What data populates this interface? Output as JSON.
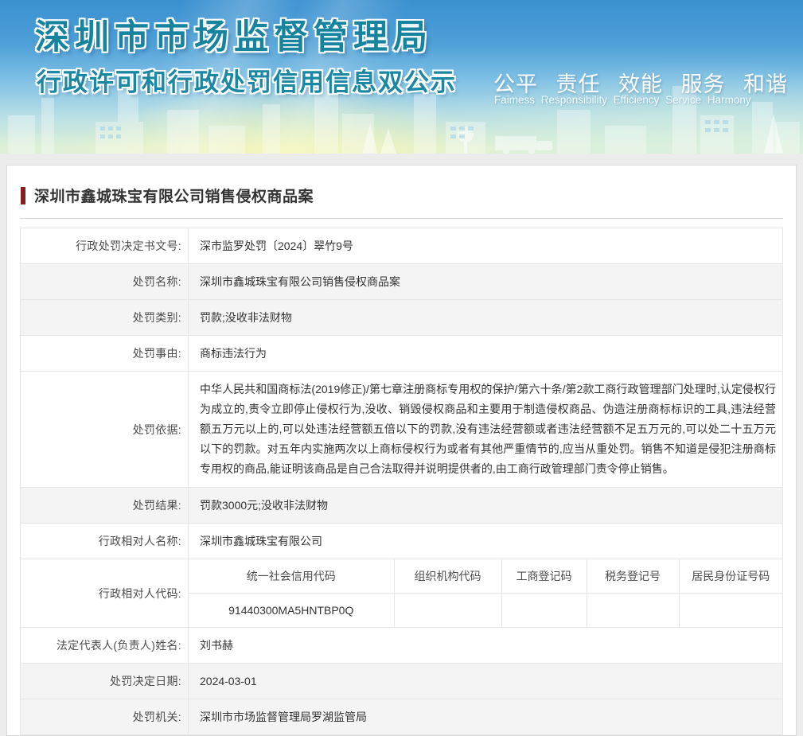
{
  "header": {
    "org_name": "深圳市市场监督管理局",
    "banner_subtitle": "行政许可和行政处罚信用信息双公示",
    "slogan_cn": "公平  责任  效能  服务  和谐",
    "slogan_en": "Faimess  Responsibility  Efficiency  Service  Harmony",
    "colors": {
      "title_teal": "#16839f",
      "top_blue": "#3a90d0",
      "bottom_glow": "#faf6aa"
    }
  },
  "page": {
    "title": "深圳市鑫城珠宝有限公司销售侵权商品案",
    "accent_color": "#8a1d22",
    "shaded_row_color": "#f4f4f4"
  },
  "penalty_table": {
    "rows": [
      {
        "label": "行政处罚决定书文号:",
        "value": "深市监罗处罚〔2024〕翠竹9号"
      },
      {
        "label": "处罚名称:",
        "value": "深圳市鑫城珠宝有限公司销售侵权商品案"
      },
      {
        "label": "处罚类别:",
        "value": "罚款;没收非法财物"
      },
      {
        "label": "处罚事由:",
        "value": "商标违法行为"
      },
      {
        "label": "处罚依据:",
        "value": "中华人民共和国商标法(2019修正)/第七章注册商标专用权的保护/第六十条/第2款工商行政管理部门处理时,认定侵权行为成立的,责令立即停止侵权行为,没收、销毁侵权商品和主要用于制造侵权商品、伪造注册商标标识的工具,违法经营额五万元以上的,可以处违法经营额五倍以下的罚款,没有违法经营额或者违法经营额不足五万元的,可以处二十五万元以下的罚款。对五年内实施两次以上商标侵权行为或者有其他严重情节的,应当从重处罚。销售不知道是侵犯注册商标专用权的商品,能证明该商品是自己合法取得并说明提供者的,由工商行政管理部门责令停止销售。"
      },
      {
        "label": "处罚结果:",
        "value": "罚款3000元;没收非法财物"
      },
      {
        "label": "行政相对人名称:",
        "value": "深圳市鑫城珠宝有限公司"
      },
      {
        "label": "法定代表人(负责人)姓名:",
        "value": "刘书赫"
      },
      {
        "label": "处罚决定日期:",
        "value": "2024-03-01"
      },
      {
        "label": "处罚机关:",
        "value": "深圳市市场监督管理局罗湖监管局"
      }
    ],
    "code_row": {
      "label": "行政相对人代码:",
      "columns": [
        "统一社会信用代码",
        "组织机构代码",
        "工商登记码",
        "税务登记号",
        "居民身份证号码"
      ],
      "values": [
        "91440300MA5HNTBP0Q",
        "",
        "",
        "",
        ""
      ]
    }
  }
}
